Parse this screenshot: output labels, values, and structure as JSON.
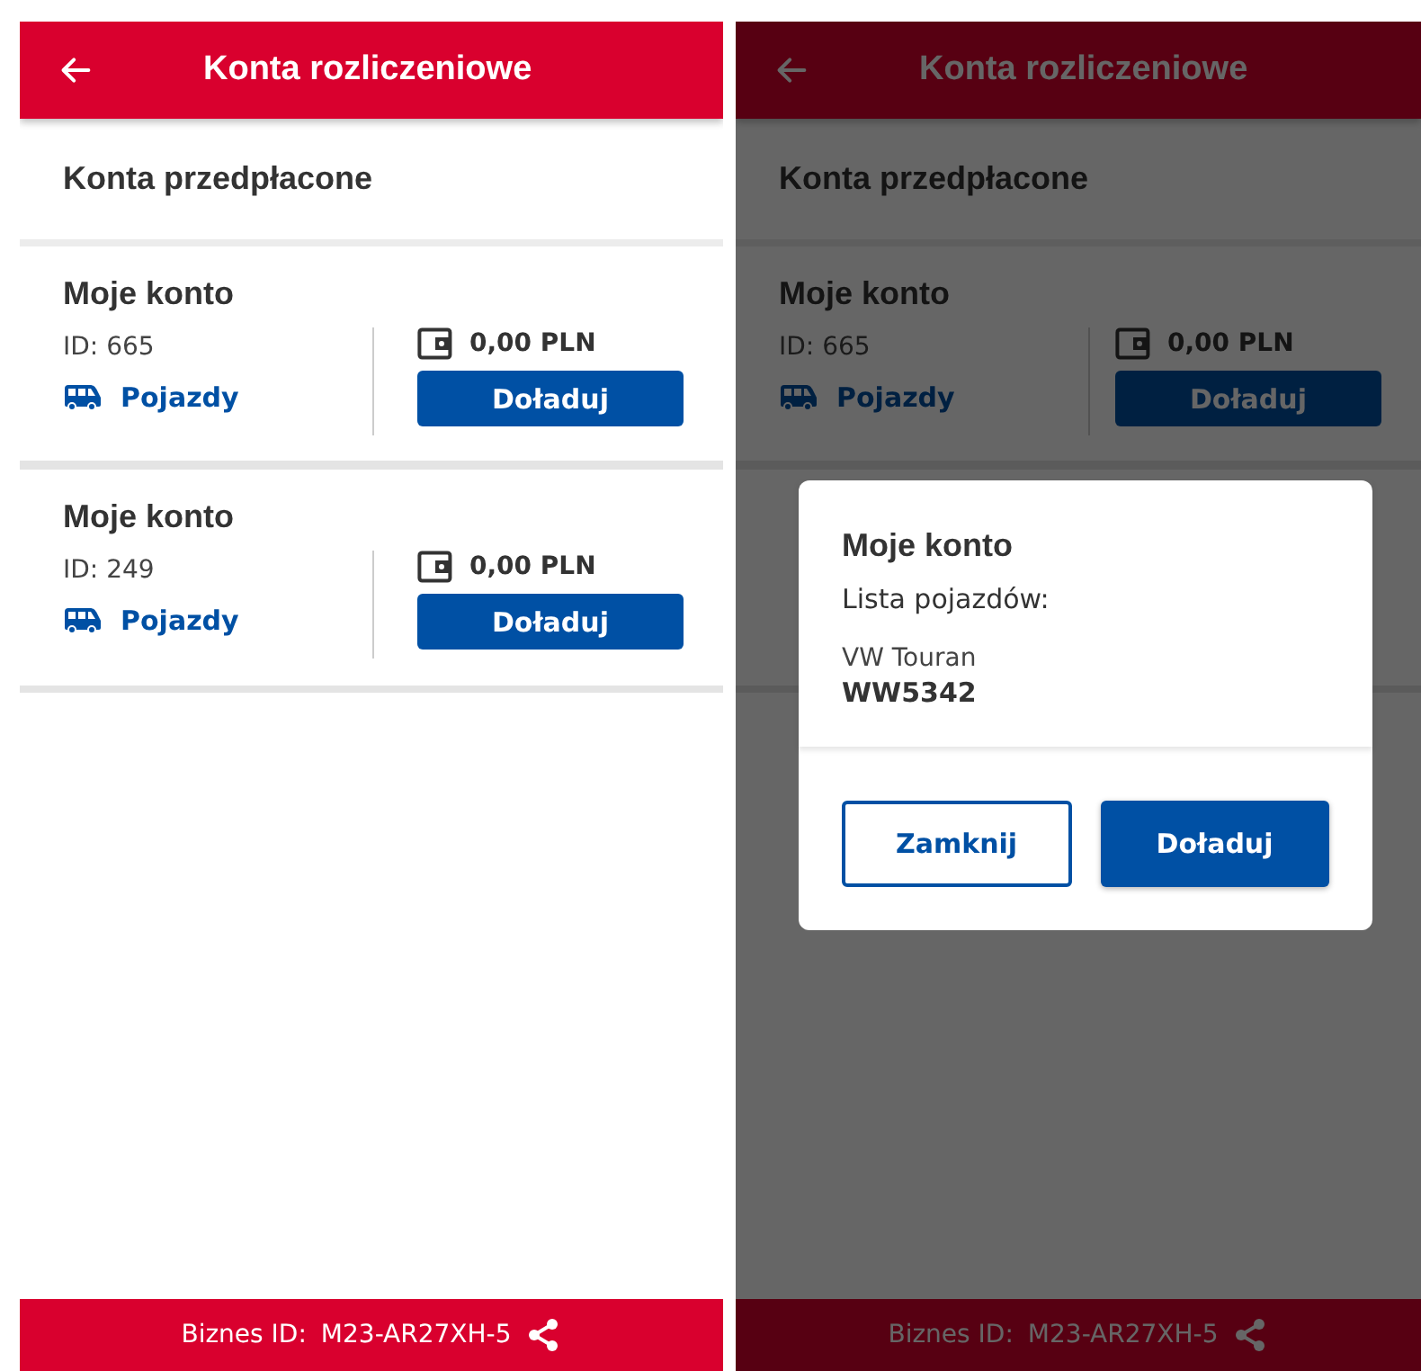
{
  "screens": [
    {
      "header": {
        "title": "Konta rozliczeniowe"
      },
      "section_title": "Konta przedpłacone",
      "accounts": [
        {
          "name": "Moje konto",
          "id": "ID: 665",
          "vehicles_link": "Pojazdy",
          "balance": "0,00 PLN",
          "top_up_button": "Doładuj"
        },
        {
          "name": "Moje konto",
          "id": "ID: 249",
          "vehicles_link": "Pojazdy",
          "balance": "0,00 PLN",
          "top_up_button": "Doładuj"
        }
      ],
      "footer": {
        "label": "Biznes ID:",
        "value": "M23-AR27XH-5"
      }
    },
    {
      "header": {
        "title": "Konta rozliczeniowe"
      },
      "section_title": "Konta przedpłacone",
      "accounts": [
        {
          "name": "Moje konto",
          "id": "ID: 665",
          "vehicles_link": "Pojazdy",
          "balance": "0,00 PLN",
          "top_up_button": "Doładuj"
        }
      ],
      "footer": {
        "label": "Biznes ID:",
        "value": "M23-AR27XH-5"
      },
      "dialog": {
        "title": "Moje konto",
        "subtitle": "Lista pojazdów:",
        "vehicles": [
          {
            "model": "VW Touran",
            "plate": "WW5342"
          }
        ],
        "buttons": [
          {
            "kind": "secondary",
            "label": "Zamknij"
          },
          {
            "kind": "primary",
            "label": "Doładuj"
          }
        ]
      }
    }
  ]
}
